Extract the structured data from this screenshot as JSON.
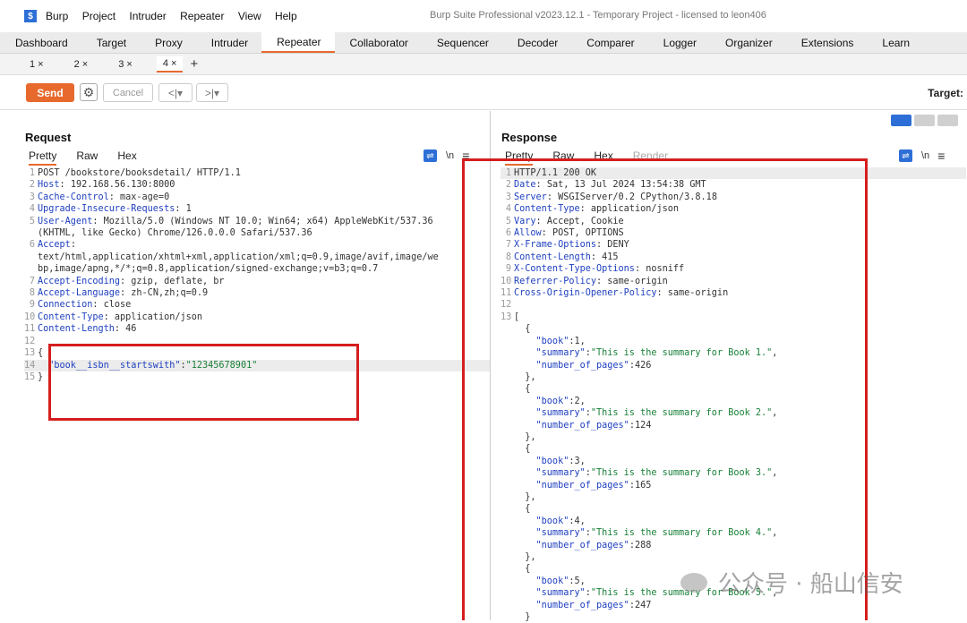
{
  "app": {
    "logo": "$",
    "menu": [
      "Burp",
      "Project",
      "Intruder",
      "Repeater",
      "View",
      "Help"
    ],
    "title": "Burp Suite Professional v2023.12.1 - Temporary Project - licensed to leon406"
  },
  "tabs": [
    "Dashboard",
    "Target",
    "Proxy",
    "Intruder",
    "Repeater",
    "Collaborator",
    "Sequencer",
    "Decoder",
    "Comparer",
    "Logger",
    "Organizer",
    "Extensions",
    "Learn"
  ],
  "active_tab": "Repeater",
  "subtabs": [
    "1 ×",
    "2 ×",
    "3 ×",
    "4 ×"
  ],
  "toolbar": {
    "send": "Send",
    "cancel": "Cancel",
    "back": "<|▾",
    "fwd": ">|▾",
    "target": "Target: "
  },
  "request": {
    "title": "Request",
    "views": [
      "Pretty",
      "Raw",
      "Hex"
    ],
    "lines": [
      {
        "n": "1",
        "k": "",
        "v": "POST /bookstore/booksdetail/ HTTP/1.1"
      },
      {
        "n": "2",
        "k": "Host",
        "v": ": 192.168.56.130:8000"
      },
      {
        "n": "3",
        "k": "Cache-Control",
        "v": ": max-age=0"
      },
      {
        "n": "4",
        "k": "Upgrade-Insecure-Requests",
        "v": ": 1"
      },
      {
        "n": "5",
        "k": "User-Agent",
        "v": ": Mozilla/5.0 (Windows NT 10.0; Win64; x64) AppleWebKit/537.36"
      },
      {
        "n": "",
        "k": "",
        "v": "(KHTML, like Gecko) Chrome/126.0.0.0 Safari/537.36"
      },
      {
        "n": "6",
        "k": "Accept",
        "v": ":"
      },
      {
        "n": "",
        "k": "",
        "v": "text/html,application/xhtml+xml,application/xml;q=0.9,image/avif,image/we"
      },
      {
        "n": "",
        "k": "",
        "v": "bp,image/apng,*/*;q=0.8,application/signed-exchange;v=b3;q=0.7"
      },
      {
        "n": "7",
        "k": "Accept-Encoding",
        "v": ": gzip, deflate, br"
      },
      {
        "n": "8",
        "k": "Accept-Language",
        "v": ": zh-CN,zh;q=0.9"
      },
      {
        "n": "9",
        "k": "Connection",
        "v": ": close"
      },
      {
        "n": "10",
        "k": "Content-Type",
        "v": ": application/json"
      },
      {
        "n": "11",
        "k": "Content-Length",
        "v": ": 46"
      },
      {
        "n": "12",
        "k": "",
        "v": ""
      },
      {
        "n": "13",
        "k": "",
        "v": "{"
      },
      {
        "n": "14",
        "k": "  \"book__isbn__startswith\"",
        "v": ":",
        "s": "\"12345678901\""
      },
      {
        "n": "15",
        "k": "",
        "v": "}"
      }
    ]
  },
  "response": {
    "title": "Response",
    "views": [
      "Pretty",
      "Raw",
      "Hex",
      "Render"
    ],
    "lines": [
      {
        "n": "1",
        "k": "",
        "v": "HTTP/1.1 200 OK"
      },
      {
        "n": "2",
        "k": "Date",
        "v": ": Sat, 13 Jul 2024 13:54:38 GMT"
      },
      {
        "n": "3",
        "k": "Server",
        "v": ": WSGIServer/0.2 CPython/3.8.18"
      },
      {
        "n": "4",
        "k": "Content-Type",
        "v": ": application/json"
      },
      {
        "n": "5",
        "k": "Vary",
        "v": ": Accept, Cookie"
      },
      {
        "n": "6",
        "k": "Allow",
        "v": ": POST, OPTIONS"
      },
      {
        "n": "7",
        "k": "X-Frame-Options",
        "v": ": DENY"
      },
      {
        "n": "8",
        "k": "Content-Length",
        "v": ": 415"
      },
      {
        "n": "9",
        "k": "X-Content-Type-Options",
        "v": ": nosniff"
      },
      {
        "n": "10",
        "k": "Referrer-Policy",
        "v": ": same-origin"
      },
      {
        "n": "11",
        "k": "Cross-Origin-Opener-Policy",
        "v": ": same-origin"
      },
      {
        "n": "12",
        "k": "",
        "v": ""
      },
      {
        "n": "13",
        "k": "",
        "v": "["
      },
      {
        "n": "",
        "k": "",
        "v": "  {"
      },
      {
        "n": "",
        "k": "    \"book\"",
        "v": ":1,"
      },
      {
        "n": "",
        "k": "    \"summary\"",
        "v": ":",
        "s": "\"This is the summary for Book 1.\"",
        "t": ","
      },
      {
        "n": "",
        "k": "    \"number_of_pages\"",
        "v": ":426"
      },
      {
        "n": "",
        "k": "",
        "v": "  },"
      },
      {
        "n": "",
        "k": "",
        "v": "  {"
      },
      {
        "n": "",
        "k": "    \"book\"",
        "v": ":2,"
      },
      {
        "n": "",
        "k": "    \"summary\"",
        "v": ":",
        "s": "\"This is the summary for Book 2.\"",
        "t": ","
      },
      {
        "n": "",
        "k": "    \"number_of_pages\"",
        "v": ":124"
      },
      {
        "n": "",
        "k": "",
        "v": "  },"
      },
      {
        "n": "",
        "k": "",
        "v": "  {"
      },
      {
        "n": "",
        "k": "    \"book\"",
        "v": ":3,"
      },
      {
        "n": "",
        "k": "    \"summary\"",
        "v": ":",
        "s": "\"This is the summary for Book 3.\"",
        "t": ","
      },
      {
        "n": "",
        "k": "    \"number_of_pages\"",
        "v": ":165"
      },
      {
        "n": "",
        "k": "",
        "v": "  },"
      },
      {
        "n": "",
        "k": "",
        "v": "  {"
      },
      {
        "n": "",
        "k": "    \"book\"",
        "v": ":4,"
      },
      {
        "n": "",
        "k": "    \"summary\"",
        "v": ":",
        "s": "\"This is the summary for Book 4.\"",
        "t": ","
      },
      {
        "n": "",
        "k": "    \"number_of_pages\"",
        "v": ":288"
      },
      {
        "n": "",
        "k": "",
        "v": "  },"
      },
      {
        "n": "",
        "k": "",
        "v": "  {"
      },
      {
        "n": "",
        "k": "    \"book\"",
        "v": ":5,"
      },
      {
        "n": "",
        "k": "    \"summary\"",
        "v": ":",
        "s": "\"This is the summary for Book 5.\"",
        "t": ","
      },
      {
        "n": "",
        "k": "    \"number_of_pages\"",
        "v": ":247"
      },
      {
        "n": "",
        "k": "",
        "v": "  }"
      }
    ]
  },
  "watermark": "公众号 · 船山信安"
}
